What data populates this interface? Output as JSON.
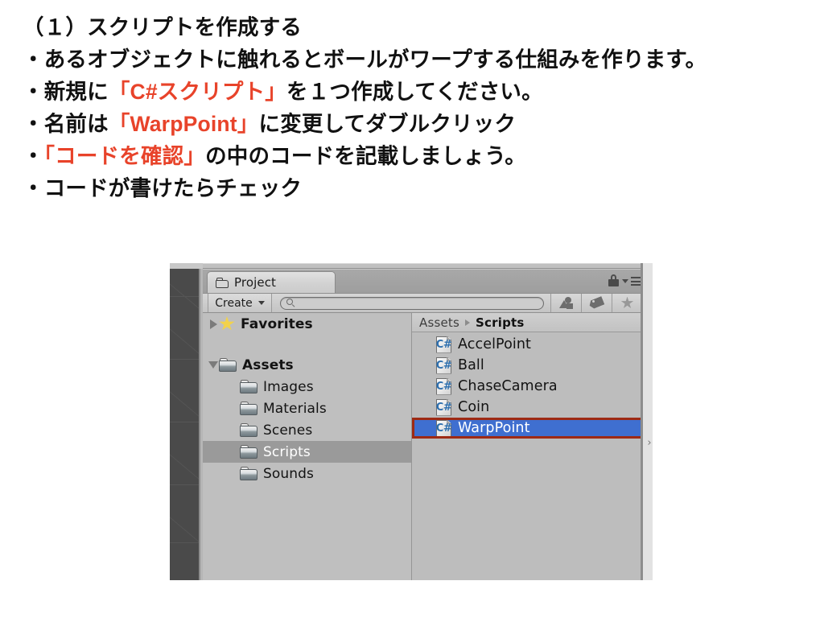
{
  "slide": {
    "lines": [
      {
        "segments": [
          {
            "text": "（１）スクリプトを作成する",
            "color": "black"
          }
        ]
      },
      {
        "segments": [
          {
            "text": "・あるオブジェクトに触れるとボールがワープする仕組みを作ります。",
            "color": "black"
          }
        ]
      },
      {
        "segments": [
          {
            "text": "・新規に",
            "color": "black"
          },
          {
            "text": "「C#スクリプト」",
            "color": "red"
          },
          {
            "text": "を１つ作成してください。",
            "color": "black"
          }
        ]
      },
      {
        "segments": [
          {
            "text": "・名前は",
            "color": "black"
          },
          {
            "text": "「WarpPoint」",
            "color": "red"
          },
          {
            "text": "に変更してダブルクリック",
            "color": "black"
          }
        ]
      },
      {
        "segments": [
          {
            "text": "・",
            "color": "black"
          },
          {
            "text": "「コードを確認」",
            "color": "red"
          },
          {
            "text": "の中のコードを記載しましょう。",
            "color": "black"
          }
        ]
      },
      {
        "segments": [
          {
            "text": "・コードが書けたらチェック",
            "color": "black"
          }
        ]
      }
    ]
  },
  "colors": {
    "accent_red": "#e8432a",
    "text_black": "#000000",
    "selection_blue": "#3f6fd0",
    "highlight_box_red": "#9e2a14",
    "tree_selected_gray": "#9a9a9a",
    "star_yellow": "#f2d24b",
    "cs_icon_blue": "#2d6fae"
  },
  "unity_project_window": {
    "tab": {
      "label": "Project",
      "icon": "folder-icon"
    },
    "titlebar_icons": [
      {
        "name": "lock-icon"
      },
      {
        "name": "panel-menu-icon"
      }
    ],
    "toolbar": {
      "create_button": {
        "label": "Create",
        "dropdown_icon": "caret-down-icon"
      },
      "search": {
        "value": "",
        "placeholder": "",
        "icon": "search-icon"
      },
      "filter_buttons": [
        {
          "name": "type-filter-icon"
        },
        {
          "name": "label-filter-icon"
        },
        {
          "name": "favorites-filter-icon"
        }
      ]
    },
    "tree": {
      "items": [
        {
          "label": "Favorites",
          "icon": "star-icon",
          "caret": "right",
          "indent": 0,
          "bold": true,
          "selected": false
        },
        {
          "label": "",
          "icon": "none",
          "caret": "none",
          "indent": 0,
          "bold": false,
          "selected": false,
          "spacer": true
        },
        {
          "label": "Assets",
          "icon": "folder-icon",
          "caret": "down",
          "indent": 0,
          "bold": true,
          "selected": false
        },
        {
          "label": "Images",
          "icon": "folder-icon",
          "caret": "none",
          "indent": 1,
          "bold": false,
          "selected": false
        },
        {
          "label": "Materials",
          "icon": "folder-icon",
          "caret": "none",
          "indent": 1,
          "bold": false,
          "selected": false
        },
        {
          "label": "Scenes",
          "icon": "folder-icon",
          "caret": "none",
          "indent": 1,
          "bold": false,
          "selected": false
        },
        {
          "label": "Scripts",
          "icon": "folder-icon",
          "caret": "none",
          "indent": 1,
          "bold": false,
          "selected": true
        },
        {
          "label": "Sounds",
          "icon": "folder-icon",
          "caret": "none",
          "indent": 1,
          "bold": false,
          "selected": false
        }
      ]
    },
    "breadcrumb": {
      "parts": [
        {
          "label": "Assets",
          "current": false
        },
        {
          "label": "Scripts",
          "current": true
        }
      ],
      "separator_icon": "chevron-right-icon"
    },
    "files": [
      {
        "name": "AccelPoint",
        "icon": "csharp-script-icon",
        "selected": false,
        "highlighted": false
      },
      {
        "name": "Ball",
        "icon": "csharp-script-icon",
        "selected": false,
        "highlighted": false
      },
      {
        "name": "ChaseCamera",
        "icon": "csharp-script-icon",
        "selected": false,
        "highlighted": false
      },
      {
        "name": "Coin",
        "icon": "csharp-script-icon",
        "selected": false,
        "highlighted": false
      },
      {
        "name": "WarpPoint",
        "icon": "csharp-script-icon",
        "selected": true,
        "highlighted": true
      }
    ],
    "resize_grabber": "›"
  }
}
